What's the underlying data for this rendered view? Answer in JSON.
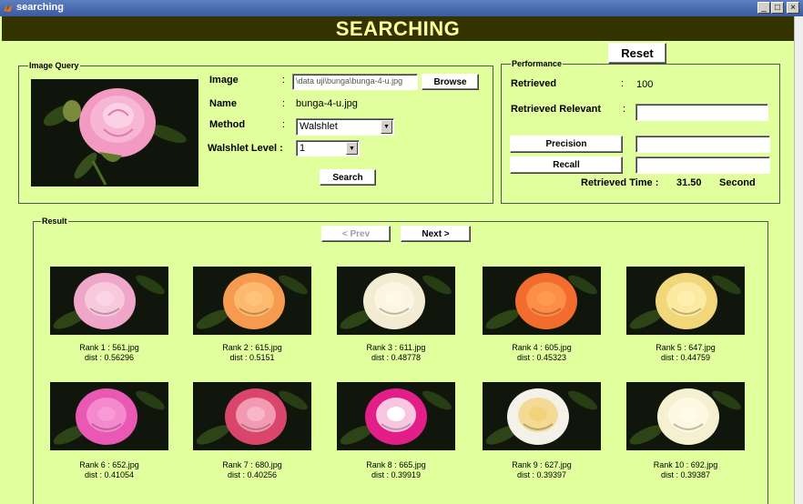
{
  "window": {
    "title": "searching",
    "minimize": "_",
    "maximize": "□",
    "close": "×"
  },
  "header": {
    "title": "SEARCHING"
  },
  "reset_label": "Reset",
  "query_panel": {
    "label": "Image Query",
    "image_label": "Image",
    "colon": ":",
    "image_path": "\\data uji\\bunga\\bunga-4-u.jpg",
    "browse_label": "Browse",
    "name_label": "Name",
    "name_value": "bunga-4-u.jpg",
    "method_label": "Method",
    "method_value": "Walshlet",
    "level_label": "Walshlet Level :",
    "level_value": "1",
    "search_label": "Search"
  },
  "performance": {
    "label": "Performance",
    "retrieved_label": "Retrieved",
    "colon": ":",
    "retrieved_value": "100",
    "relevant_label": "Retrieved Relevant",
    "relevant_colon": ":",
    "precision_label": "Precision",
    "recall_label": "Recall",
    "time_label": "Retrieved Time :",
    "time_value": "31.50",
    "time_unit": "Second"
  },
  "result": {
    "label": "Result",
    "prev_label": "< Prev",
    "next_label": "Next >",
    "items": [
      {
        "rank": "Rank 1 : 561.jpg",
        "dist": "dist  : 0.56296",
        "color": "#f0a6c8",
        "center": "#fbd3e4"
      },
      {
        "rank": "Rank 2 : 615.jpg",
        "dist": "dist  : 0.5151",
        "color": "#f59a4e",
        "center": "#ffc47a"
      },
      {
        "rank": "Rank 3 : 611.jpg",
        "dist": "dist  : 0.48778",
        "color": "#f3ecd2",
        "center": "#fff8e6"
      },
      {
        "rank": "Rank 4 : 605.jpg",
        "dist": "dist  : 0.45323",
        "color": "#f26c2e",
        "center": "#ff9a50"
      },
      {
        "rank": "Rank 5 : 647.jpg",
        "dist": "dist  : 0.44759",
        "color": "#f2d77a",
        "center": "#fff0b0"
      },
      {
        "rank": "Rank 6 : 652.jpg",
        "dist": "dist  : 0.41054",
        "color": "#ea58b5",
        "center": "#f79ad6"
      },
      {
        "rank": "Rank 7 : 680.jpg",
        "dist": "dist  : 0.40256",
        "color": "#d9456b",
        "center": "#f8b7c8"
      },
      {
        "rank": "Rank 8 : 665.jpg",
        "dist": "dist  : 0.39919",
        "color": "#e31e88",
        "center": "#ffffff"
      },
      {
        "rank": "Rank 9 : 627.jpg",
        "dist": "dist  : 0.39397",
        "color": "#f4f2e8",
        "center": "#f3d27a"
      },
      {
        "rank": "Rank 10 : 692.jpg",
        "dist": "dist  : 0.39387",
        "color": "#f5f0cf",
        "center": "#fffbe8"
      }
    ]
  },
  "colors": {
    "background": "#e1ff9c",
    "banner": "#333300",
    "banner_text": "#ffff99",
    "query_rose": "#f29ac2"
  }
}
